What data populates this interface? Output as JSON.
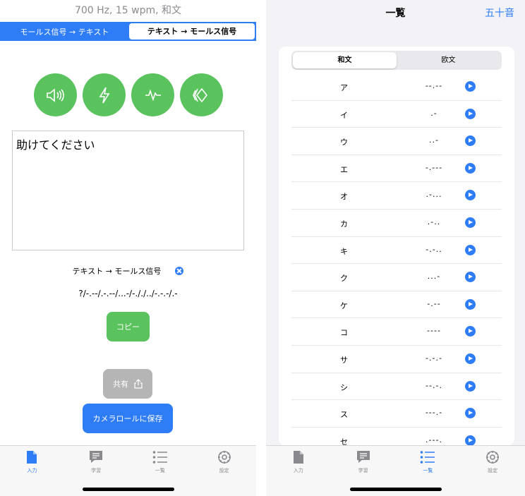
{
  "left": {
    "status_line": "700 Hz, 15 wpm, 和文",
    "segment": {
      "option1": "モールス信号 → テキスト",
      "option2": "テキスト → モールス信号"
    },
    "round_buttons": [
      "speaker-icon",
      "flash-icon",
      "pulse-icon",
      "vibrate-icon"
    ],
    "input_text": "助けてください",
    "direction_label": "テキスト → モールス信号",
    "morse_output": "?/-.--/.-.--/...-/-././../-.-.-/.-",
    "copy_label": "コピー",
    "share_label": "共有",
    "save_label": "カメラロールに保存"
  },
  "tabs": [
    {
      "label": "入力",
      "icon": "document-icon"
    },
    {
      "label": "学習",
      "icon": "chat-icon"
    },
    {
      "label": "一覧",
      "icon": "list-icon"
    },
    {
      "label": "設定",
      "icon": "gear-icon"
    }
  ],
  "colors": {
    "accent": "#2f7df6",
    "green": "#5ac35e",
    "gray_button": "#b5b5b5"
  },
  "right": {
    "nav_title": "一覧",
    "nav_right": "五十音",
    "segment": {
      "option1": "和文",
      "option2": "欧文"
    },
    "rows": [
      {
        "kana": "ア",
        "code": "--.--"
      },
      {
        "kana": "イ",
        "code": ".-"
      },
      {
        "kana": "ウ",
        "code": "..-"
      },
      {
        "kana": "エ",
        "code": "-.---"
      },
      {
        "kana": "オ",
        "code": ".-..."
      },
      {
        "kana": "カ",
        "code": ".-.."
      },
      {
        "kana": "キ",
        "code": "-.-.."
      },
      {
        "kana": "ク",
        "code": "...-"
      },
      {
        "kana": "ケ",
        "code": "-.--"
      },
      {
        "kana": "コ",
        "code": "----"
      },
      {
        "kana": "サ",
        "code": "-.-.-"
      },
      {
        "kana": "シ",
        "code": "--.-."
      },
      {
        "kana": "ス",
        "code": "---.-"
      },
      {
        "kana": "セ",
        "code": ".---."
      }
    ]
  }
}
